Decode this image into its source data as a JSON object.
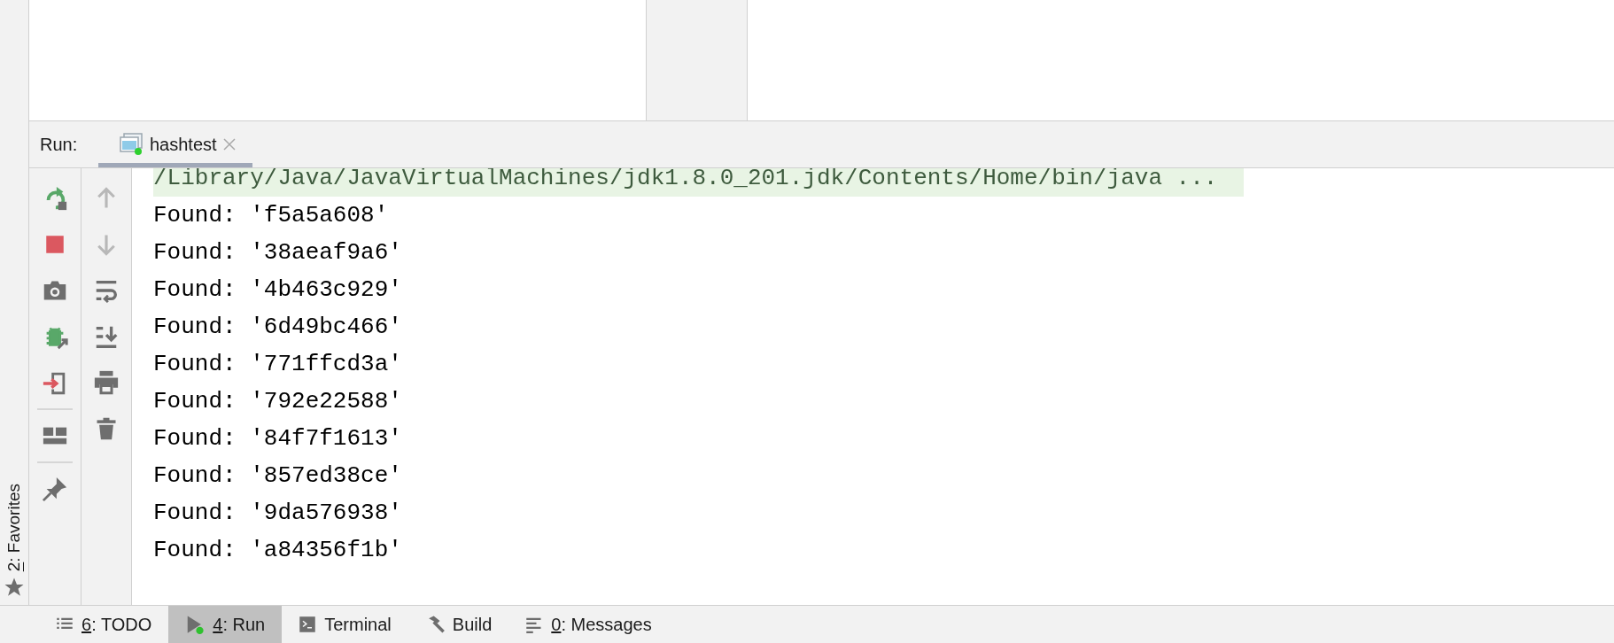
{
  "favorites_stripe": {
    "label": "2: Favorites"
  },
  "run_panel": {
    "label": "Run:",
    "tabs": [
      {
        "label": "hashtest",
        "selected": true
      }
    ],
    "console": [
      {
        "kind": "command",
        "text": "/Library/Java/JavaVirtualMachines/jdk1.8.0_201.jdk/Contents/Home/bin/java ..."
      },
      {
        "kind": "output",
        "text": "Found: 'f5a5a608'"
      },
      {
        "kind": "output",
        "text": "Found: '38aeaf9a6'"
      },
      {
        "kind": "output",
        "text": "Found: '4b463c929'"
      },
      {
        "kind": "output",
        "text": "Found: '6d49bc466'"
      },
      {
        "kind": "output",
        "text": "Found: '771ffcd3a'"
      },
      {
        "kind": "output",
        "text": "Found: '792e22588'"
      },
      {
        "kind": "output",
        "text": "Found: '84f7f1613'"
      },
      {
        "kind": "output",
        "text": "Found: '857ed38ce'"
      },
      {
        "kind": "output",
        "text": "Found: '9da576938'"
      },
      {
        "kind": "output",
        "text": "Found: 'a84356f1b'"
      }
    ]
  },
  "bottom_tool_tabs": [
    {
      "label": "6: TODO",
      "selected": false,
      "mnemonic": true
    },
    {
      "label": "4: Run",
      "selected": true,
      "mnemonic": true
    },
    {
      "label": "Terminal",
      "selected": false,
      "mnemonic": false
    },
    {
      "label": "Build",
      "selected": false,
      "mnemonic": false
    },
    {
      "label": "0: Messages",
      "selected": false,
      "mnemonic": true
    }
  ]
}
